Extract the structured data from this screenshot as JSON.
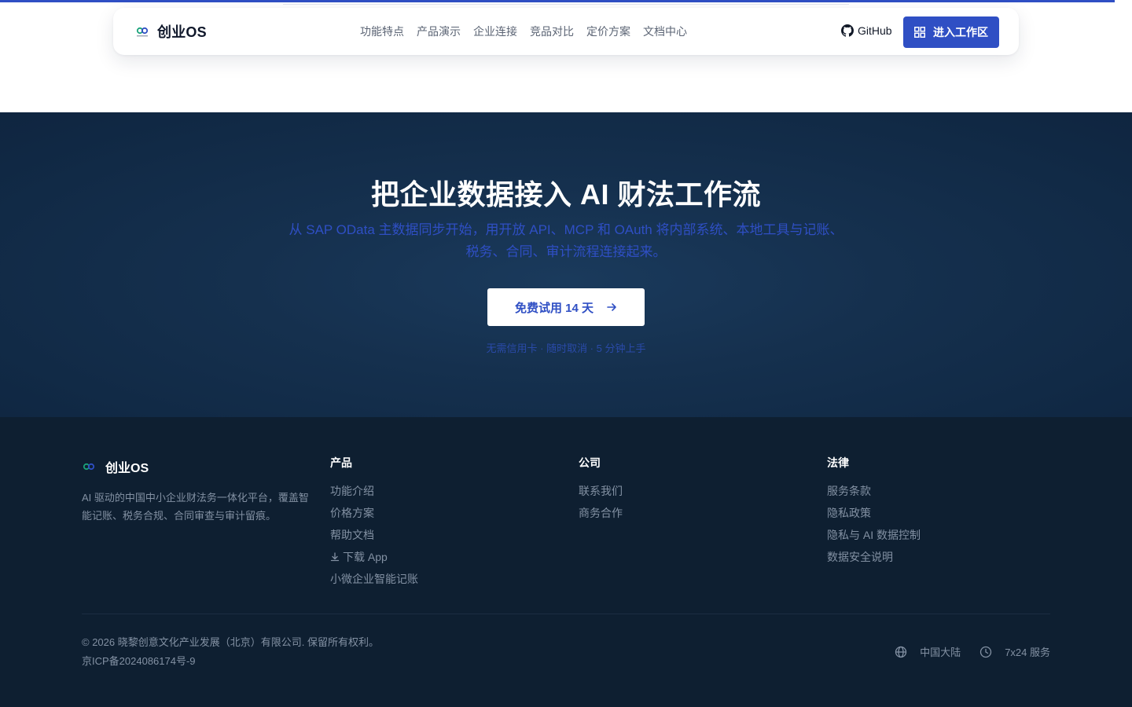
{
  "brand": {
    "name": "创业OS"
  },
  "nav": {
    "links": [
      "功能特点",
      "产品演示",
      "企业连接",
      "竞品对比",
      "定价方案",
      "文档中心"
    ],
    "github_label": "GitHub",
    "cta_label": "进入工作区"
  },
  "hero": {
    "title": "把企业数据接入 AI 财法工作流",
    "subtitle": "从 SAP OData 主数据同步开始，用开放 API、MCP 和 OAuth 将内部系统、本地工具与记账、税务、合同、审计流程连接起来。",
    "cta_label": "免费试用 14 天",
    "note": "无需信用卡 · 随时取消 · 5 分钟上手"
  },
  "footer": {
    "brand_name": "创业OS",
    "description": "AI 驱动的中国中小企业财法务一体化平台，覆盖智能记账、税务合规、合同审查与审计留痕。",
    "columns": [
      {
        "title": "产品",
        "links": [
          "功能介绍",
          "价格方案",
          "帮助文档",
          "下载 App",
          "小微企业智能记账"
        ]
      },
      {
        "title": "公司",
        "links": [
          "联系我们",
          "商务合作"
        ]
      },
      {
        "title": "法律",
        "links": [
          "服务条款",
          "隐私政策",
          "隐私与 AI 数据控制",
          "数据安全说明"
        ]
      }
    ],
    "copyright": "© 2026 晓黎创意文化产业发展（北京）有限公司. 保留所有权利。",
    "icp": "京ICP备2024086174号-9",
    "region": "中国大陆",
    "service": "7x24 服务"
  },
  "colors": {
    "accent": "#2f4fc4",
    "hero_bg": "#15304e",
    "footer_bg": "#0e1f31"
  },
  "icons": [
    "logo-mark",
    "github-icon",
    "grid-icon",
    "arrow-right-icon",
    "download-icon",
    "globe-icon",
    "clock-icon"
  ]
}
